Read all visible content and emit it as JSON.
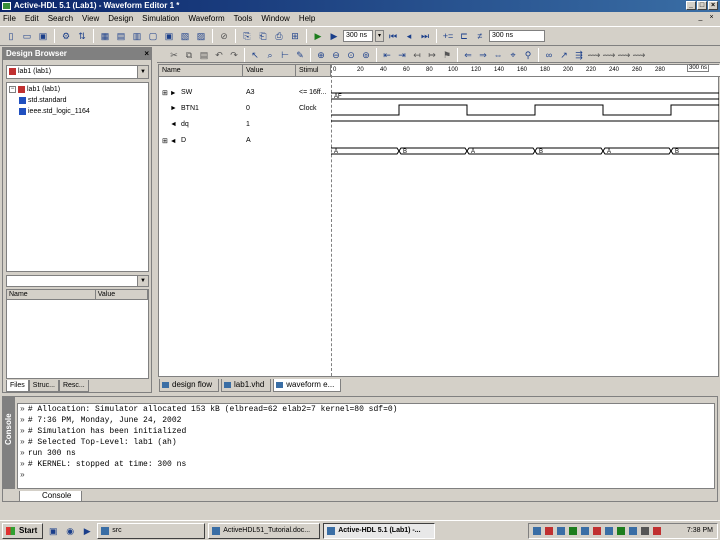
{
  "window": {
    "title": "Active-HDL 5.1 (Lab1) - Waveform Editor 1 *"
  },
  "menu": [
    "File",
    "Edit",
    "Search",
    "View",
    "Design",
    "Simulation",
    "Waveform",
    "Tools",
    "Window",
    "Help"
  ],
  "toolbar": {
    "sim_time": "300 ns",
    "run_time": "300 ns"
  },
  "browser": {
    "title": "Design Browser",
    "combo": "lab1 (lab1)",
    "tree": [
      "lab1 (lab1)",
      "std.standard",
      "ieee.std_logic_1164"
    ],
    "props_cols": [
      "Name",
      "Value"
    ],
    "tabs": [
      "Files",
      "Struc...",
      "Resc..."
    ]
  },
  "wave": {
    "columns": [
      "Name",
      "Value",
      "Stimul"
    ],
    "ruler": [
      "0",
      "20",
      "40",
      "60",
      "80",
      "100",
      "120",
      "140",
      "160",
      "180",
      "200",
      "220",
      "240",
      "260",
      "280"
    ],
    "ruler_unit": "300 ns",
    "signals": [
      {
        "prefix": "⊞ ►",
        "name": "SW",
        "value": "A3",
        "stim": "<= 16ff..."
      },
      {
        "prefix": "►",
        "name": "BTN1",
        "value": "0",
        "stim": "Clock"
      },
      {
        "prefix": "◄",
        "name": "dq",
        "value": "1",
        "stim": ""
      },
      {
        "prefix": "⊞ ◄",
        "name": "D",
        "value": "A",
        "stim": ""
      }
    ],
    "sw_bus_value": "AF",
    "d_bus_labels": [
      "A",
      "B",
      "A",
      "B",
      "A",
      "B"
    ],
    "tabs": [
      "design flow",
      "lab1.vhd",
      "waveform e..."
    ]
  },
  "console": {
    "side_label": "Console",
    "lines": [
      {
        "pre": "»",
        "text": "# Allocation: Simulator allocated 153 kB (elbread=62 elab2=7 kernel=80 sdf=0)"
      },
      {
        "pre": "»",
        "text": "# 7:36 PM, Monday, June 24, 2002"
      },
      {
        "pre": "»",
        "text": "# Simulation has been initialized"
      },
      {
        "pre": "»",
        "text": "# Selected Top-Level: lab1 (ah)"
      },
      {
        "pre": "»",
        "text": "run 300 ns"
      },
      {
        "pre": "»",
        "text": "# KERNEL: stopped at time: 300 ns"
      },
      {
        "pre": "»",
        "text": ""
      }
    ],
    "tab": "Console"
  },
  "taskbar": {
    "start": "Start",
    "tasks": [
      "src",
      "ActiveHDL51_Tutorial.doc...",
      "Active-HDL 5.1 (Lab1) -..."
    ],
    "clock": "7:38 PM"
  },
  "colors": {
    "title_bar": "#0a246a",
    "wave_line": "#000000"
  }
}
